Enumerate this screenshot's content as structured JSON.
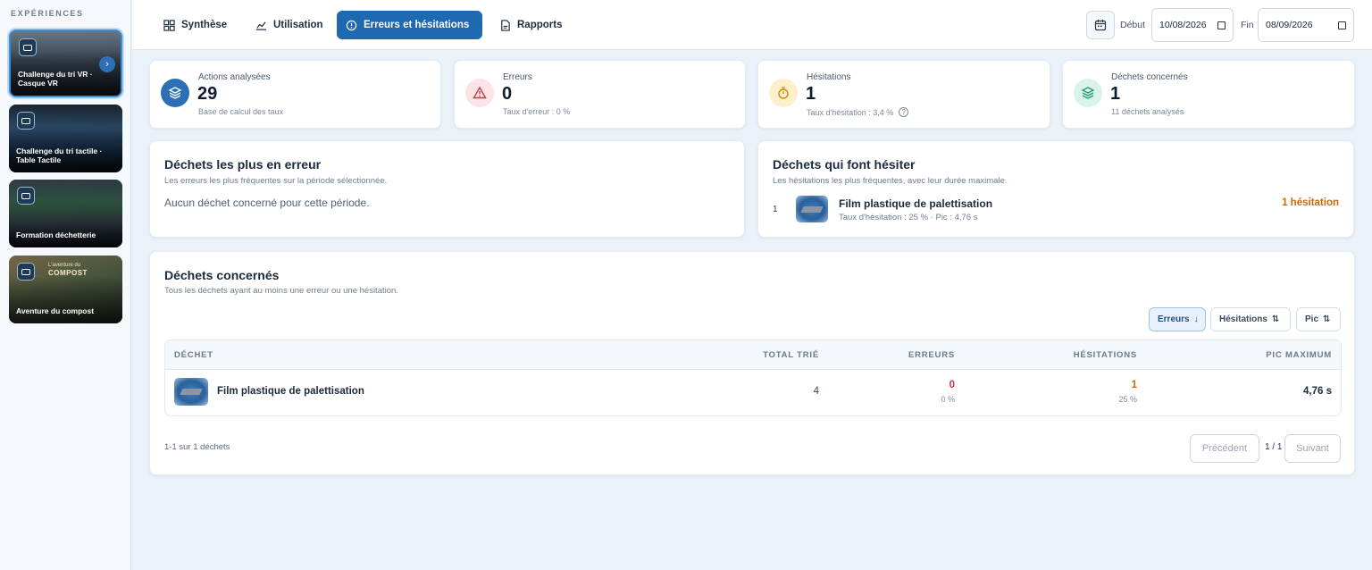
{
  "sidebar": {
    "title": "EXPÉRIENCES",
    "items": [
      {
        "label": "Challenge du tri VR · Casque VR",
        "active": true
      },
      {
        "label": "Challenge du tri tactile · Table Tactile",
        "active": false
      },
      {
        "label": "Formation déchetterie",
        "active": false
      },
      {
        "label": "Aventure du compost",
        "active": false
      }
    ],
    "compost_caption": "L'aventure du",
    "compost_title": "COMPOST"
  },
  "header": {
    "tabs": [
      {
        "label": "Synthèse",
        "icon": "grid-icon",
        "active": false
      },
      {
        "label": "Utilisation",
        "icon": "chart-icon",
        "active": false
      },
      {
        "label": "Erreurs et hésitations",
        "icon": "alert-circle-icon",
        "active": true
      },
      {
        "label": "Rapports",
        "icon": "document-icon",
        "active": false
      }
    ],
    "start_label": "Début",
    "start_value": "10/08/2026",
    "end_label": "Fin",
    "end_value": "08/09/2026"
  },
  "stats": [
    {
      "label": "Actions analysées",
      "value": "29",
      "sub": "Base de calcul des taux",
      "color": "#2d6fb5",
      "icon": "layers-icon"
    },
    {
      "label": "Erreurs",
      "value": "0",
      "sub": "Taux d'erreur : 0 %",
      "color": "#c43a4b",
      "icon": "warning-icon"
    },
    {
      "label": "Hésitations",
      "value": "1",
      "sub": "Taux d'hésitation : 3,4 %",
      "color": "#c98a12",
      "icon": "timer-icon"
    },
    {
      "label": "Déchets concernés",
      "value": "1",
      "sub": "11 déchets analysés",
      "color": "#1f9c6a",
      "icon": "stack-icon"
    }
  ],
  "errors_panel": {
    "title": "Déchets les plus en erreur",
    "subtitle": "Les erreurs les plus fréquentes sur la période sélectionnée.",
    "empty": "Aucun déchet concerné pour cette période."
  },
  "hesitation_panel": {
    "title": "Déchets qui font hésiter",
    "subtitle": "Les hésitations les plus fréquentes, avec leur durée maximale.",
    "items": [
      {
        "rank": "1",
        "name": "Film plastique de palettisation",
        "detail": "Taux d'hésitation : 25 % · Pic : 4,76 s",
        "count": "1 hésitation"
      }
    ]
  },
  "concerned": {
    "title": "Déchets concernés",
    "subtitle": "Tous les déchets ayant au moins une erreur ou une hésitation.",
    "sort_buttons": [
      {
        "label": "Erreurs",
        "arrow": "↓",
        "active": true
      },
      {
        "label": "Hésitations",
        "arrow": "⇅",
        "active": false
      },
      {
        "label": "Pic",
        "arrow": "⇅",
        "active": false
      }
    ],
    "columns": [
      "DÉCHET",
      "TOTAL TRIÉ",
      "ERREURS",
      "HÉSITATIONS",
      "PIC MAXIMUM"
    ],
    "rows": [
      {
        "name": "Film plastique de palettisation",
        "total": "4",
        "errors": "0",
        "errors_pct": "0 %",
        "hesitations": "1",
        "hesitations_pct": "25 %",
        "peak": "4,76 s"
      }
    ],
    "count_text": "1-1 sur 1 déchets",
    "prev": "Précédent",
    "page": "1 / 1",
    "next": "Suivant"
  }
}
